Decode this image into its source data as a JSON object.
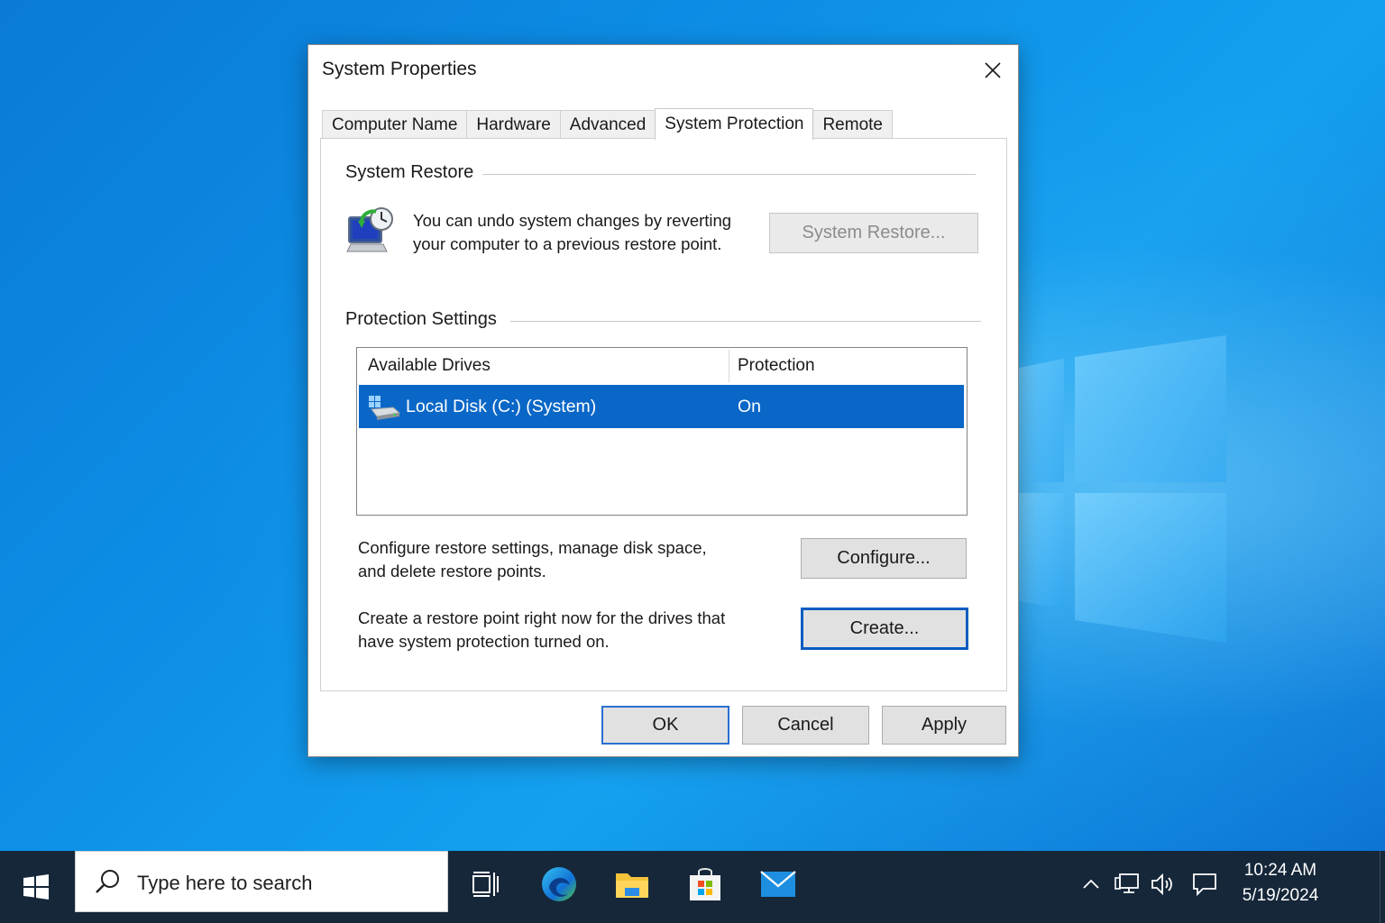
{
  "dialog": {
    "title": "System Properties",
    "tabs": [
      "Computer Name",
      "Hardware",
      "Advanced",
      "System Protection",
      "Remote"
    ],
    "active_tab": "System Protection"
  },
  "system_restore": {
    "group_title": "System Restore",
    "description_line1": "You can undo system changes by reverting",
    "description_line2": "your computer to a previous restore point.",
    "button_label": "System Restore..."
  },
  "protection_settings": {
    "group_title": "Protection Settings",
    "columns": [
      "Available Drives",
      "Protection"
    ],
    "drives": [
      {
        "name": "Local Disk (C:) (System)",
        "protection": "On",
        "selected": true
      }
    ],
    "configure_desc_line1": "Configure restore settings, manage disk space,",
    "configure_desc_line2": "and delete restore points.",
    "configure_label": "Configure...",
    "create_desc_line1": "Create a restore point right now for the drives that",
    "create_desc_line2": "have system protection turned on.",
    "create_label": "Create..."
  },
  "footer": {
    "ok_label": "OK",
    "cancel_label": "Cancel",
    "apply_label": "Apply"
  },
  "taskbar": {
    "search_placeholder": "Type here to search",
    "time": "10:24 AM",
    "date": "5/19/2024",
    "apps": [
      "task-view-icon",
      "edge-icon",
      "file-explorer-icon",
      "store-icon",
      "mail-icon"
    ]
  },
  "colors": {
    "selection": "#0a67c7",
    "desktop": "#0d8fe6",
    "taskbar": "#16273a"
  }
}
